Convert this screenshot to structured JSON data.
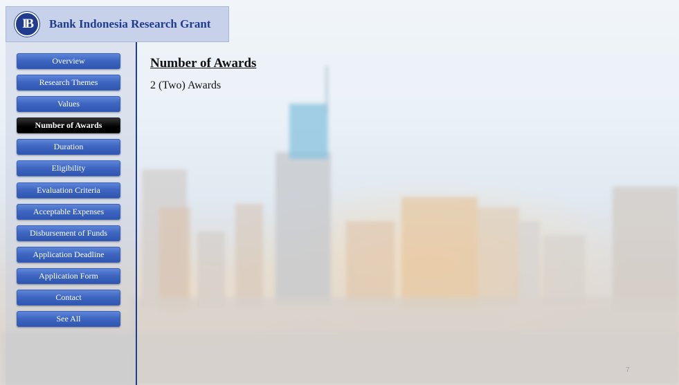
{
  "header": {
    "title": "Bank Indonesia Research Grant",
    "logo_icon": "bank-indonesia-logo-icon"
  },
  "nav": {
    "items": [
      {
        "label": "Overview",
        "active": false
      },
      {
        "label": "Research Themes",
        "active": false
      },
      {
        "label": "Values",
        "active": false
      },
      {
        "label": "Number of Awards",
        "active": true
      },
      {
        "label": "Duration",
        "active": false
      },
      {
        "label": "Eligibility",
        "active": false
      },
      {
        "label": "Evaluation Criteria",
        "active": false
      },
      {
        "label": "Acceptable Expenses",
        "active": false
      },
      {
        "label": "Disbursement of Funds",
        "active": false
      },
      {
        "label": "Application Deadline",
        "active": false
      },
      {
        "label": "Application Form",
        "active": false
      },
      {
        "label": "Contact",
        "active": false
      },
      {
        "label": "See All",
        "active": false
      }
    ]
  },
  "main": {
    "heading": "Number of Awards",
    "body": "2 (Two) Awards"
  },
  "footer": {
    "page_number": "7"
  },
  "colors": {
    "brand_blue": "#1f3c8f",
    "button_blue": "#3f67c2",
    "active_button": "#000000",
    "title_tab": "#c7d1ea"
  }
}
